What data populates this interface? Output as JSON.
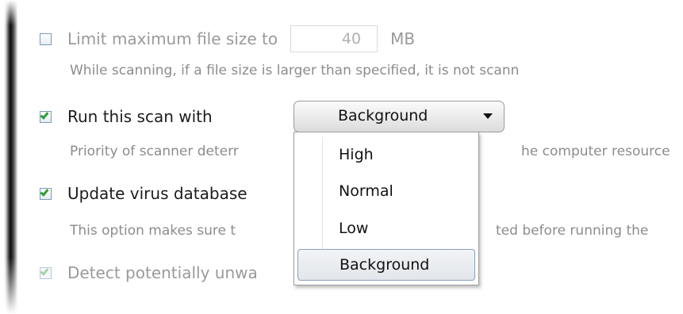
{
  "options": {
    "limit_size": {
      "label": "Limit maximum file size to",
      "value": "40",
      "unit": "MB",
      "checked": false,
      "description": "While scanning, if a file size is larger than specified, it is not scann"
    },
    "run_scan": {
      "label": "Run this scan with",
      "checked": true,
      "description": "Priority of scanner deterr",
      "description_tail": "he computer resource"
    },
    "update_db": {
      "label": "Update virus database",
      "checked": true,
      "description": "This option makes sure t",
      "description_tail": "ted before running the"
    },
    "detect_pua": {
      "label": "Detect potentially unwa",
      "checked": true,
      "disabled": true
    }
  },
  "priority_select": {
    "selected": "Background",
    "options": [
      "High",
      "Normal",
      "Low",
      "Background"
    ]
  },
  "colors": {
    "checkmark": "#2e9b32",
    "checkbox_border": "#7a9ab8",
    "description_text": "#8c8c8c"
  },
  "icons": {
    "dropdown_arrow": "chevron-down-icon",
    "check": "check-icon"
  }
}
